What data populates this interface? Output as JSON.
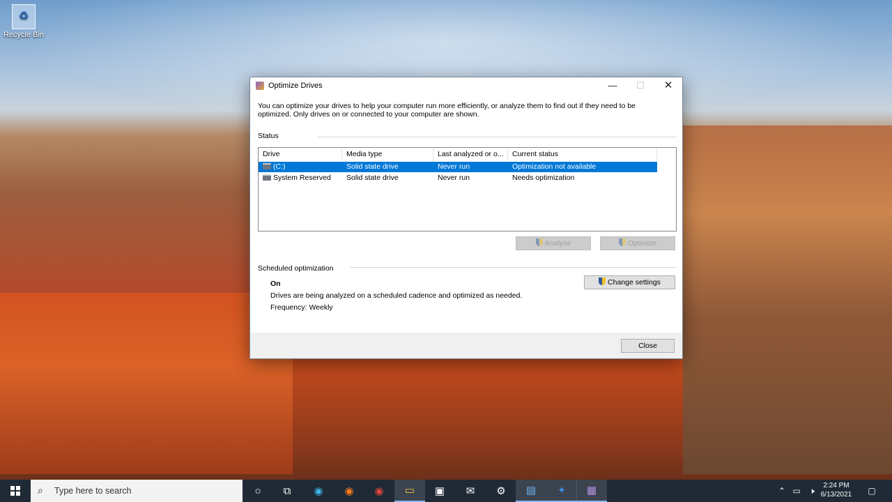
{
  "desktop": {
    "recycle_bin_label": "Recycle Bin"
  },
  "window": {
    "title": "Optimize Drives",
    "intro": "You can optimize your drives to help your computer run more efficiently, or analyze them to find out if they need to be optimized. Only drives on or connected to your computer are shown.",
    "status_heading": "Status",
    "columns": [
      "Drive",
      "Media type",
      "Last analyzed or o...",
      "Current status"
    ],
    "drives": [
      {
        "drive": "(C:)",
        "media_type": "Solid state drive",
        "last_analyzed": "Never run",
        "current_status": "Optimization not available",
        "selected": true
      },
      {
        "drive": "System Reserved",
        "media_type": "Solid state drive",
        "last_analyzed": "Never run",
        "current_status": "Needs optimization",
        "selected": false
      }
    ],
    "analyze_label": "Analyze",
    "optimize_label": "Optimize",
    "scheduled_heading": "Scheduled optimization",
    "schedule_state": "On",
    "schedule_description": "Drives are being analyzed on a scheduled cadence and optimized as needed.",
    "schedule_frequency": "Frequency: Weekly",
    "change_settings_label": "Change settings",
    "close_label": "Close"
  },
  "taskbar": {
    "search_placeholder": "Type here to search",
    "time": "2:24 PM",
    "date": "6/13/2021",
    "apps": [
      "cortana-icon",
      "task-view-icon",
      "edge-icon",
      "firefox-icon",
      "chrome-icon",
      "file-explorer-icon",
      "store-icon",
      "mail-icon",
      "settings-icon",
      "control-panel-icon",
      "azure-icon",
      "defrag-icon"
    ]
  },
  "colors": {
    "selection": "#0078d7",
    "taskbar": "#1f2a36"
  }
}
